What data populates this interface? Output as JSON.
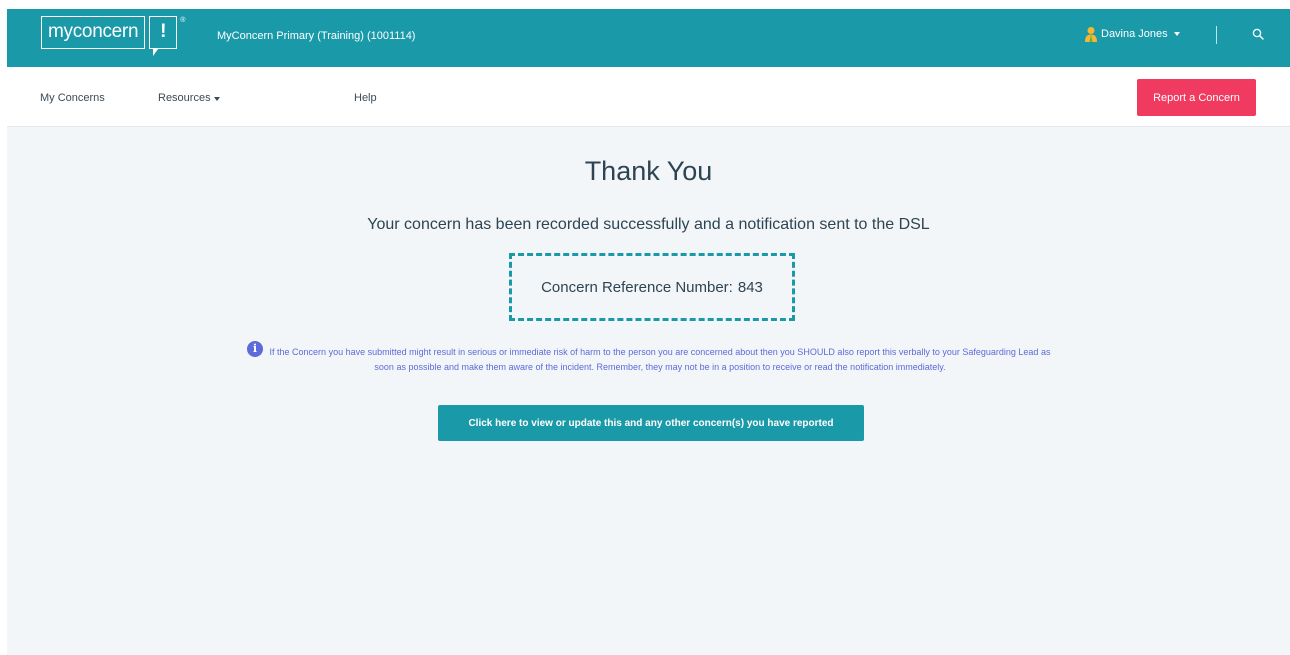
{
  "header": {
    "logo_word": "myconcern",
    "logo_mark": "!",
    "logo_reg": "®",
    "org_name": "MyConcern Primary (Training) (1001114)",
    "user_name": "Davina Jones",
    "icons": {
      "user": "user-icon",
      "search": "search-icon"
    }
  },
  "nav": {
    "items": [
      {
        "label": "My Concerns"
      },
      {
        "label": "Resources"
      },
      {
        "label": "Help"
      }
    ],
    "report_button": "Report a Concern"
  },
  "main": {
    "title": "Thank You",
    "success_message": "Your concern has been recorded successfully and a notification sent to the DSL",
    "reference_label": "Concern Reference Number:",
    "reference_number": "843",
    "info_icon": "info-icon",
    "info_text": "If the Concern you have submitted might result in serious or immediate risk of harm to the person you are concerned about then you SHOULD also report this verbally to your Safeguarding Lead as soon as possible and make them aware of the incident. Remember, they may not be in a position to receive or read the notification immediately.",
    "view_button": "Click here to view or update this and any other concern(s) you have reported"
  },
  "colors": {
    "brand_teal": "#1a9aa9",
    "report_red": "#f03a5f",
    "info_purple": "#5d6ad9",
    "page_bg": "#f2f6f9"
  }
}
